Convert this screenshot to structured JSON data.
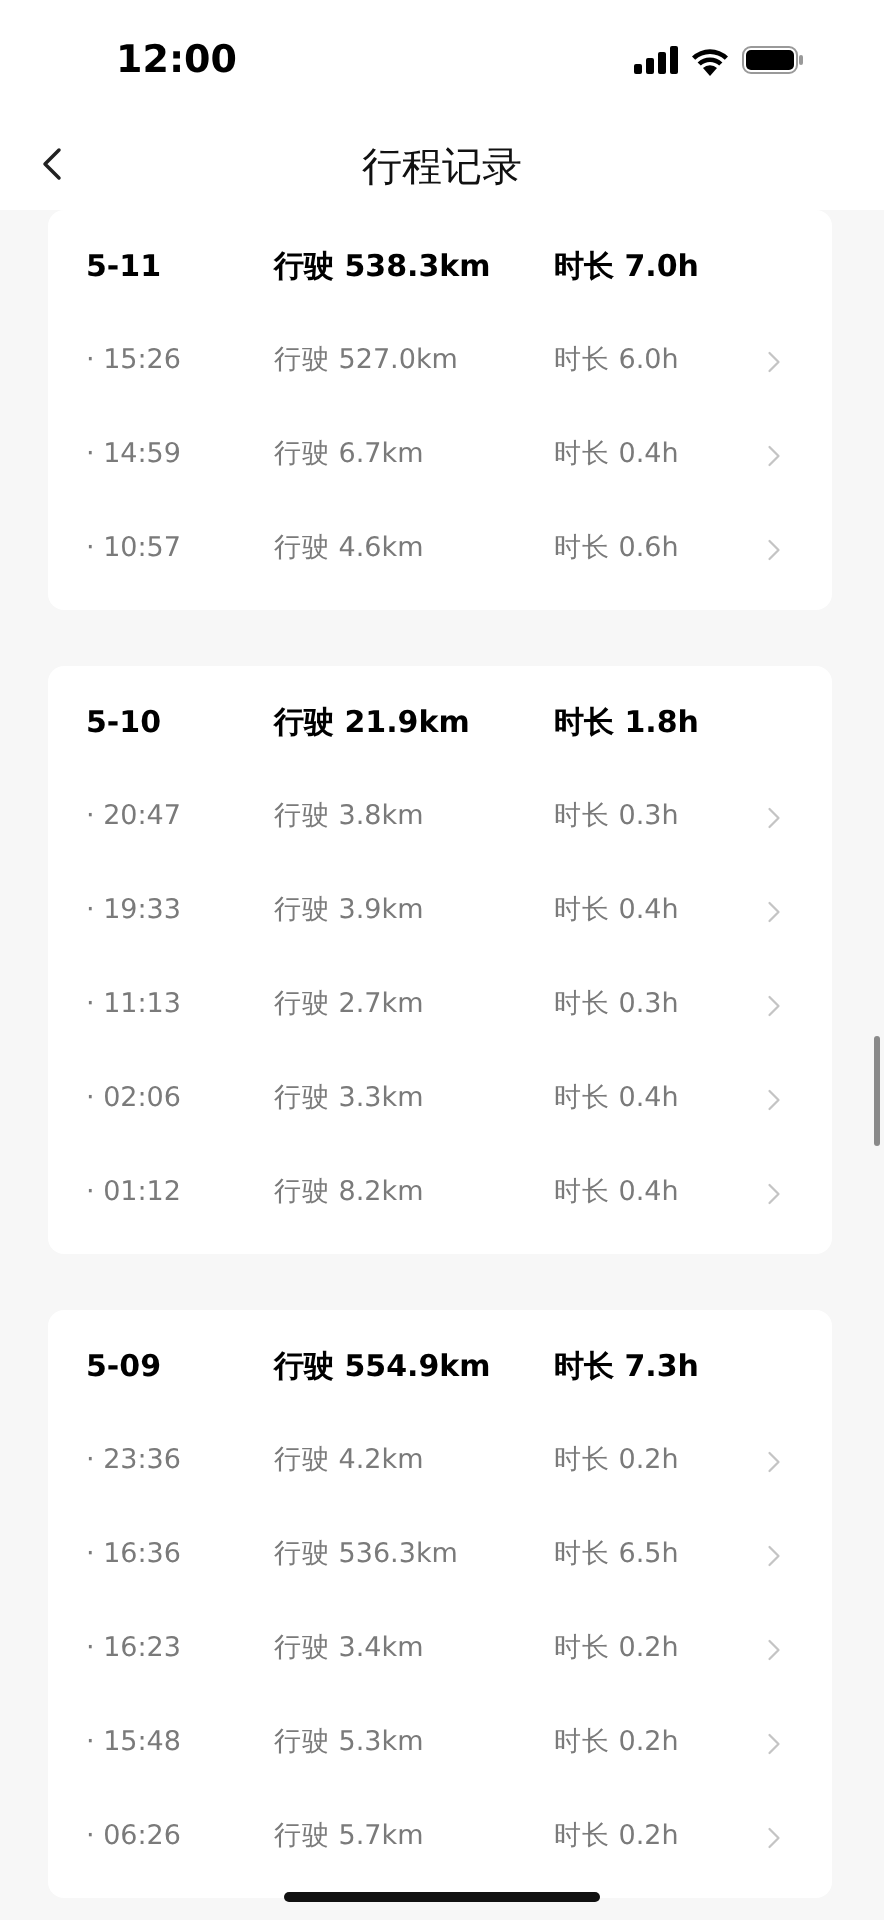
{
  "status_bar": {
    "time": "12:00"
  },
  "nav": {
    "title": "行程记录"
  },
  "days": [
    {
      "date": "5-11",
      "distance": "行驶 538.3km",
      "duration": "时长 7.0h",
      "trips": [
        {
          "time": "· 15:26",
          "distance": "行驶 527.0km",
          "duration": "时长 6.0h"
        },
        {
          "time": "· 14:59",
          "distance": "行驶 6.7km",
          "duration": "时长 0.4h"
        },
        {
          "time": "· 10:57",
          "distance": "行驶 4.6km",
          "duration": "时长 0.6h"
        }
      ]
    },
    {
      "date": "5-10",
      "distance": "行驶 21.9km",
      "duration": "时长 1.8h",
      "trips": [
        {
          "time": "· 20:47",
          "distance": "行驶 3.8km",
          "duration": "时长 0.3h"
        },
        {
          "time": "· 19:33",
          "distance": "行驶 3.9km",
          "duration": "时长 0.4h"
        },
        {
          "time": "· 11:13",
          "distance": "行驶 2.7km",
          "duration": "时长 0.3h"
        },
        {
          "time": "· 02:06",
          "distance": "行驶 3.3km",
          "duration": "时长 0.4h"
        },
        {
          "time": "· 01:12",
          "distance": "行驶 8.2km",
          "duration": "时长 0.4h"
        }
      ]
    },
    {
      "date": "5-09",
      "distance": "行驶 554.9km",
      "duration": "时长 7.3h",
      "trips": [
        {
          "time": "· 23:36",
          "distance": "行驶 4.2km",
          "duration": "时长 0.2h"
        },
        {
          "time": "· 16:36",
          "distance": "行驶 536.3km",
          "duration": "时长 6.5h"
        },
        {
          "time": "· 16:23",
          "distance": "行驶 3.4km",
          "duration": "时长 0.2h"
        },
        {
          "time": "· 15:48",
          "distance": "行驶 5.3km",
          "duration": "时长 0.2h"
        },
        {
          "time": "· 06:26",
          "distance": "行驶 5.7km",
          "duration": "时长 0.2h"
        }
      ]
    }
  ]
}
